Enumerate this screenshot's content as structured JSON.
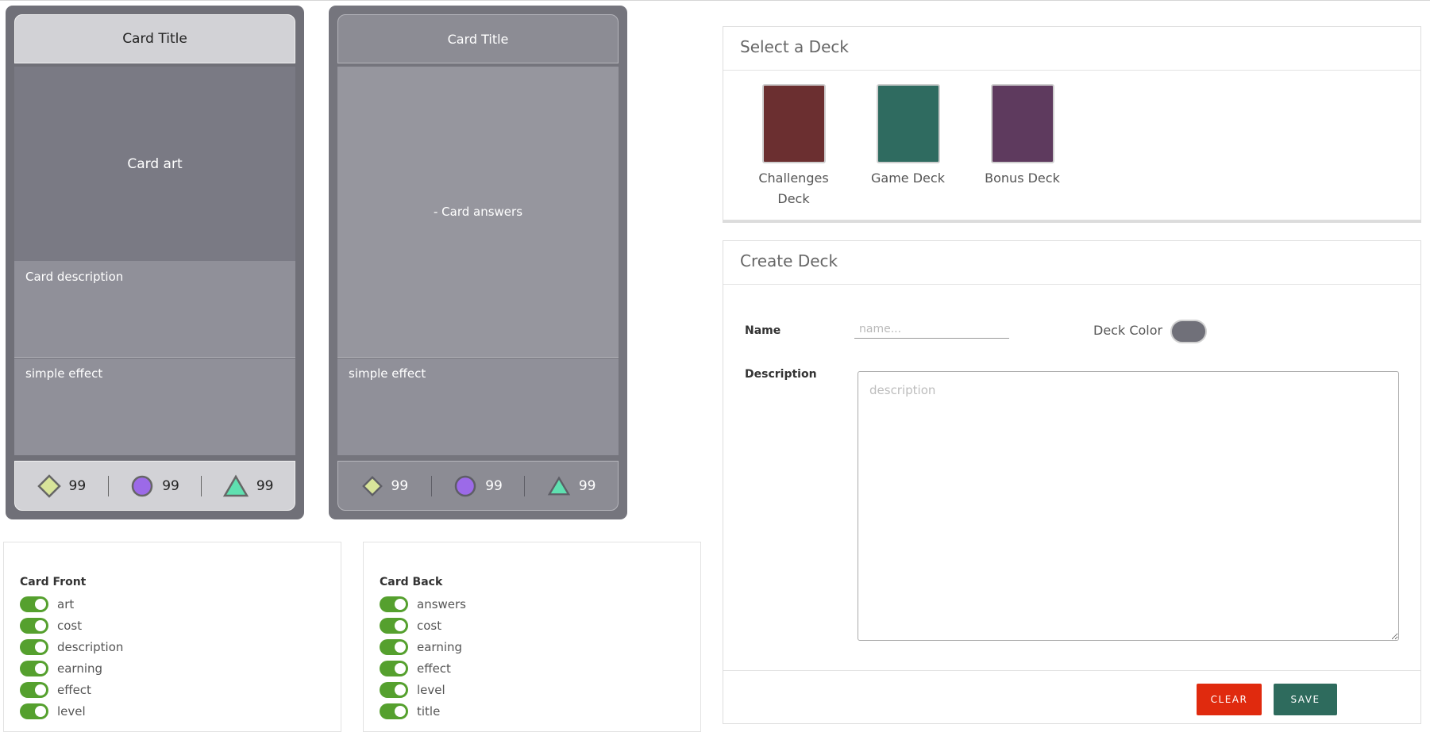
{
  "card_front": {
    "title": "Card Title",
    "art": "Card art",
    "description": "Card description",
    "effect": "simple effect",
    "stats": [
      {
        "icon": "diamond-icon",
        "color": "#d8e49a",
        "value": "99"
      },
      {
        "icon": "circle-icon",
        "color": "#9c6ae8",
        "value": "99"
      },
      {
        "icon": "triangle-icon",
        "color": "#5fe0b0",
        "value": "99"
      }
    ]
  },
  "card_back": {
    "title": "Card Title",
    "answers": "- Card answers",
    "effect": "simple effect",
    "stats": [
      {
        "icon": "diamond-icon",
        "color": "#d8e49a",
        "value": "99"
      },
      {
        "icon": "circle-icon",
        "color": "#9c6ae8",
        "value": "99"
      },
      {
        "icon": "triangle-icon",
        "color": "#5fe0b0",
        "value": "99"
      }
    ]
  },
  "front_toggles": {
    "heading": "Card Front",
    "items": [
      "art",
      "cost",
      "description",
      "earning",
      "effect",
      "level"
    ]
  },
  "back_toggles": {
    "heading": "Card Back",
    "items": [
      "answers",
      "cost",
      "earning",
      "effect",
      "level",
      "title"
    ]
  },
  "select_deck": {
    "title": "Select a Deck",
    "decks": [
      {
        "label": "Challenges Deck",
        "color": "#6b2f30"
      },
      {
        "label": "Game Deck",
        "color": "#2f6b60"
      },
      {
        "label": "Bonus Deck",
        "color": "#5e3a5e"
      }
    ]
  },
  "create_deck": {
    "title": "Create Deck",
    "name_label": "Name",
    "name_placeholder": "name...",
    "color_label": "Deck Color",
    "deck_color": "#707079",
    "description_label": "Description",
    "description_placeholder": "description",
    "clear_label": "CLEAR",
    "save_label": "SAVE"
  }
}
